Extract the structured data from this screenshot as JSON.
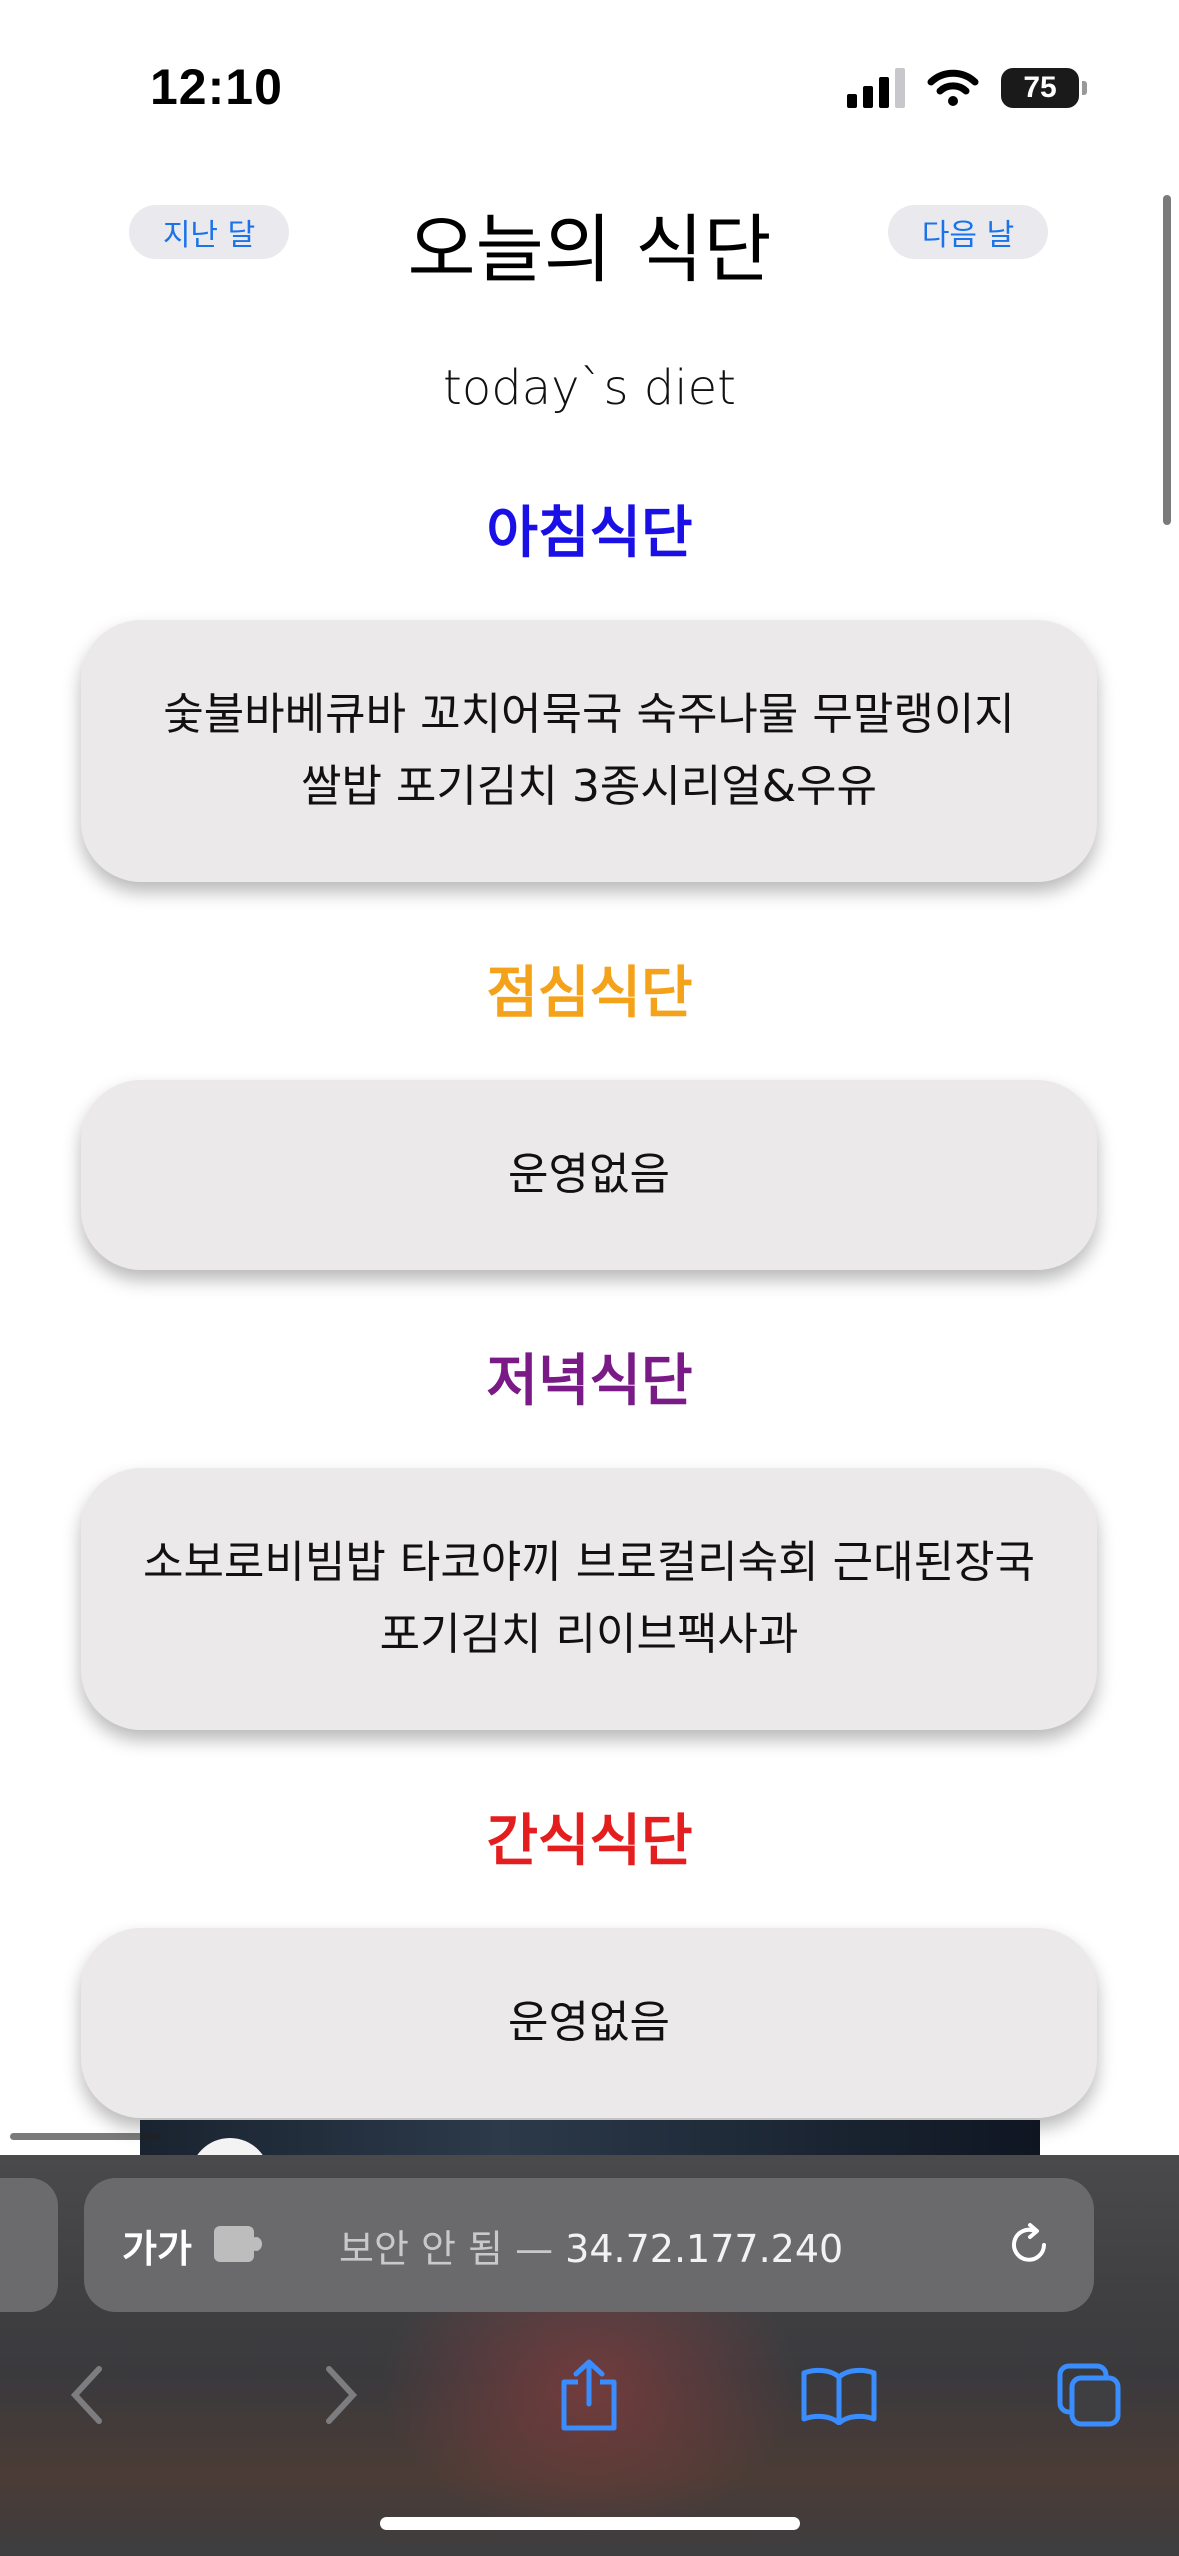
{
  "status_bar": {
    "time": "12:10",
    "battery": "75"
  },
  "header": {
    "prev_label": "지난 달",
    "title": "오늘의 식단",
    "next_label": "다음 날",
    "subtitle": "today`s diet"
  },
  "meals": [
    {
      "title": "아침식단",
      "color": "#1a10e6",
      "menu": "숯불바베큐바 꼬치어묵국 숙주나물 무말랭이지 쌀밥 포기김치 3종시리얼&우유"
    },
    {
      "title": "점심식단",
      "color": "#f5a21b",
      "menu": "운영없음"
    },
    {
      "title": "저녁식단",
      "color": "#7a1a86",
      "menu": "소보로비빔밥 타코야끼 브로컬리숙회 근대된장국 포기김치 리이브팩사과"
    },
    {
      "title": "간식식단",
      "color": "#e41e1e",
      "menu": "운영없음"
    }
  ],
  "browser": {
    "text_size_label": "가가",
    "security_label": "보안 안 됨 —",
    "url": "34.72.177.240",
    "icons": [
      "puzzle-icon",
      "reload-icon",
      "back-icon",
      "forward-icon",
      "share-icon",
      "bookmarks-icon",
      "tabs-icon"
    ]
  }
}
